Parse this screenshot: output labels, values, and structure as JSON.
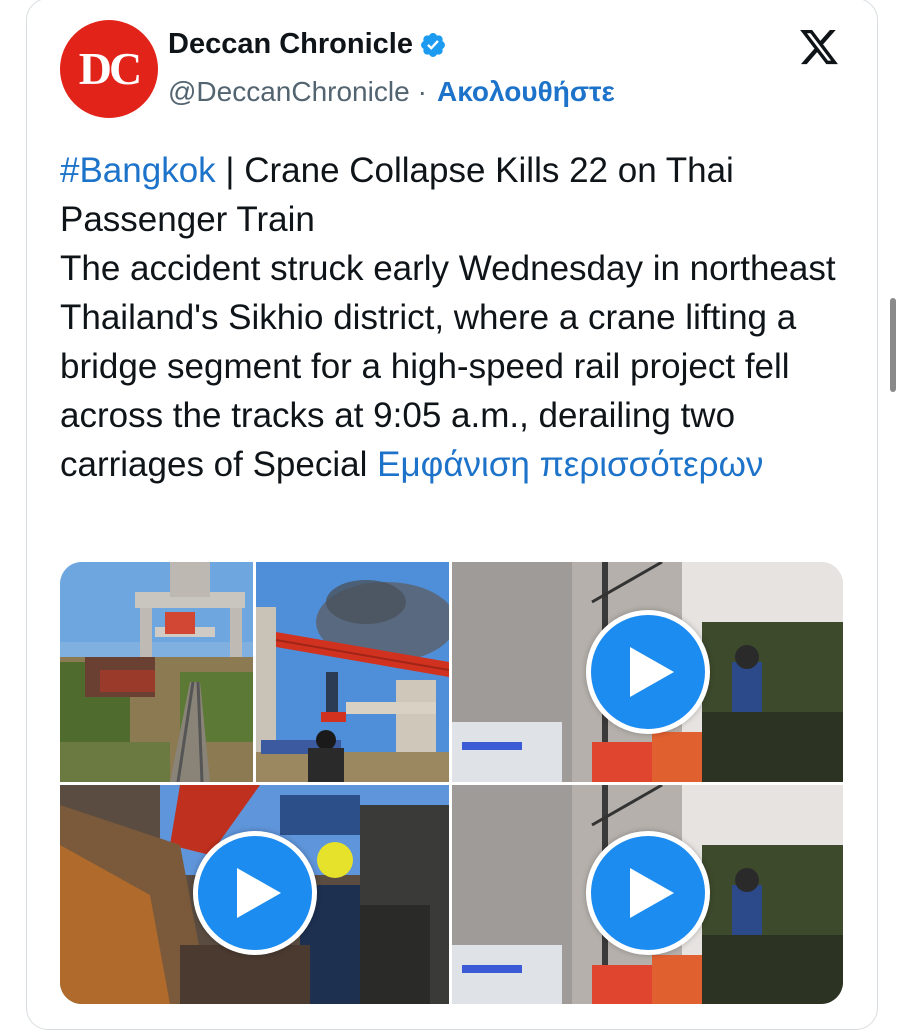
{
  "account": {
    "avatar_text": "DC",
    "name": "Deccan Chronicle",
    "handle": "@DeccanChronicle",
    "separator": "·",
    "follow_label": "Ακολουθήστε"
  },
  "tweet": {
    "hashtag": "#Bangkok",
    "line1_rest": " | Crane Collapse Kills 22 on Thai Passenger Train",
    "body": "The accident struck early Wednesday in northeast Thailand's Sikhio district, where a crane lifting a bridge segment for a high-speed rail project fell across the tracks at 9:05 a.m., derailing two carriages of Special ",
    "show_more": "Εμφάνιση περισσότερων"
  },
  "media": {
    "tiles": [
      {
        "kind": "photo",
        "subject": "derailed-train-under-bridge"
      },
      {
        "kind": "photo",
        "subject": "collapsed-red-crane"
      },
      {
        "kind": "video",
        "subject": "rescuers-at-wall"
      },
      {
        "kind": "video",
        "subject": "wreckage-closeup"
      },
      {
        "kind": "video",
        "subject": "rescuers-at-wall"
      }
    ]
  },
  "colors": {
    "link": "#1d73c9",
    "avatar_bg": "#e2231a",
    "verified": "#1d9bf0",
    "play_button": "#1d8cf0"
  },
  "icons": [
    "verified-badge-icon",
    "x-logo-icon",
    "play-icon"
  ]
}
